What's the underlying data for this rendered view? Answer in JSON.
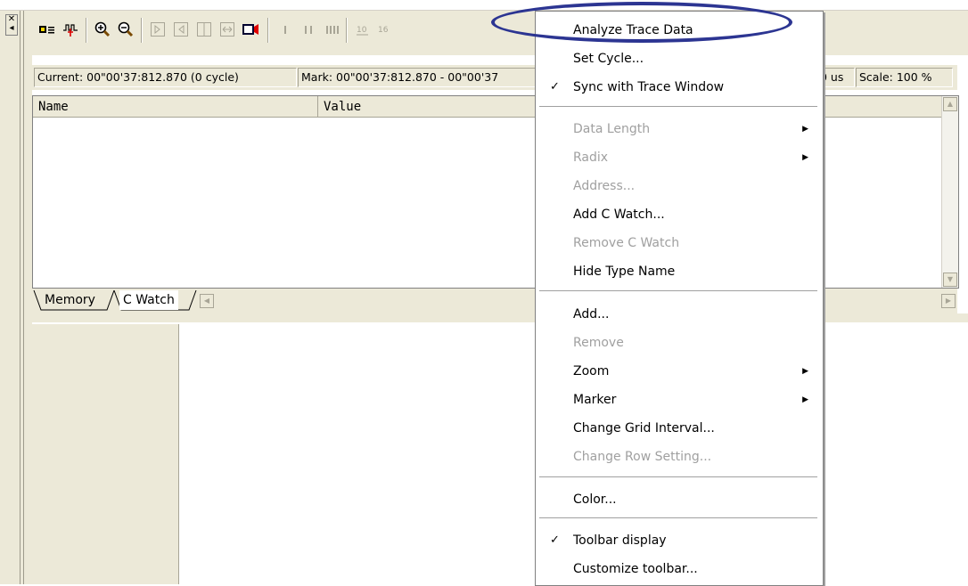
{
  "status": {
    "current": "Current: 00\"00'37:812.870 (0 cycle)",
    "mark": "Mark: 00\"00'37:812.870 - 00\"00'37",
    "interval": "0 us",
    "scale": "Scale: 100 %"
  },
  "table": {
    "col_name": "Name",
    "col_value": "Value"
  },
  "tabs": {
    "memory": "Memory",
    "cwatch": "C Watch"
  },
  "menu": {
    "items": [
      {
        "label": "Analyze Trace Data",
        "enabled": true
      },
      {
        "label": "Set Cycle...",
        "enabled": true
      },
      {
        "label": "Sync with Trace Window",
        "enabled": true,
        "checked": true
      },
      {
        "label": "Data Length",
        "enabled": false,
        "submenu": true
      },
      {
        "label": "Radix",
        "enabled": false,
        "submenu": true
      },
      {
        "label": "Address...",
        "enabled": false
      },
      {
        "label": "Add C Watch...",
        "enabled": true
      },
      {
        "label": "Remove C Watch",
        "enabled": false
      },
      {
        "label": "Hide Type Name",
        "enabled": true
      },
      {
        "label": "Add...",
        "enabled": true
      },
      {
        "label": "Remove",
        "enabled": false
      },
      {
        "label": "Zoom",
        "enabled": true,
        "submenu": true
      },
      {
        "label": "Marker",
        "enabled": true,
        "submenu": true
      },
      {
        "label": "Change Grid Interval...",
        "enabled": true
      },
      {
        "label": "Change Row Setting...",
        "enabled": false
      },
      {
        "label": "Color...",
        "enabled": true
      },
      {
        "label": "Toolbar display",
        "enabled": true,
        "checked": true
      },
      {
        "label": "Customize toolbar...",
        "enabled": true
      }
    ]
  },
  "colors": {
    "highlight_ellipse": "#2c3592",
    "chrome": "#ece9d8"
  }
}
